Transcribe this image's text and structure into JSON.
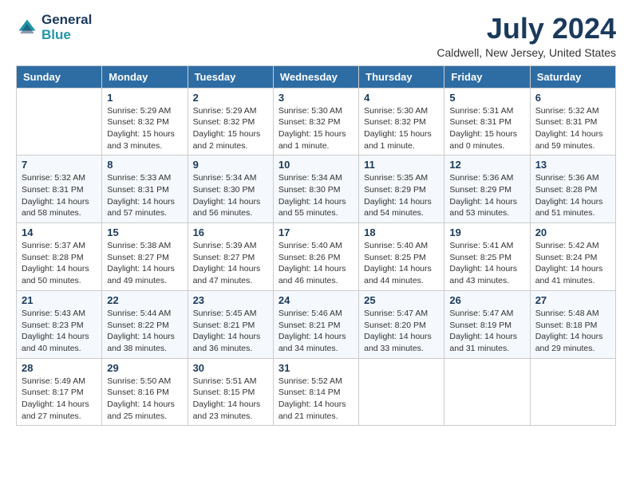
{
  "header": {
    "logo_line1": "General",
    "logo_line2": "Blue",
    "month_year": "July 2024",
    "location": "Caldwell, New Jersey, United States"
  },
  "days_of_week": [
    "Sunday",
    "Monday",
    "Tuesday",
    "Wednesday",
    "Thursday",
    "Friday",
    "Saturday"
  ],
  "weeks": [
    [
      {
        "day": "",
        "info": ""
      },
      {
        "day": "1",
        "info": "Sunrise: 5:29 AM\nSunset: 8:32 PM\nDaylight: 15 hours\nand 3 minutes."
      },
      {
        "day": "2",
        "info": "Sunrise: 5:29 AM\nSunset: 8:32 PM\nDaylight: 15 hours\nand 2 minutes."
      },
      {
        "day": "3",
        "info": "Sunrise: 5:30 AM\nSunset: 8:32 PM\nDaylight: 15 hours\nand 1 minute."
      },
      {
        "day": "4",
        "info": "Sunrise: 5:30 AM\nSunset: 8:32 PM\nDaylight: 15 hours\nand 1 minute."
      },
      {
        "day": "5",
        "info": "Sunrise: 5:31 AM\nSunset: 8:31 PM\nDaylight: 15 hours\nand 0 minutes."
      },
      {
        "day": "6",
        "info": "Sunrise: 5:32 AM\nSunset: 8:31 PM\nDaylight: 14 hours\nand 59 minutes."
      }
    ],
    [
      {
        "day": "7",
        "info": "Sunrise: 5:32 AM\nSunset: 8:31 PM\nDaylight: 14 hours\nand 58 minutes."
      },
      {
        "day": "8",
        "info": "Sunrise: 5:33 AM\nSunset: 8:31 PM\nDaylight: 14 hours\nand 57 minutes."
      },
      {
        "day": "9",
        "info": "Sunrise: 5:34 AM\nSunset: 8:30 PM\nDaylight: 14 hours\nand 56 minutes."
      },
      {
        "day": "10",
        "info": "Sunrise: 5:34 AM\nSunset: 8:30 PM\nDaylight: 14 hours\nand 55 minutes."
      },
      {
        "day": "11",
        "info": "Sunrise: 5:35 AM\nSunset: 8:29 PM\nDaylight: 14 hours\nand 54 minutes."
      },
      {
        "day": "12",
        "info": "Sunrise: 5:36 AM\nSunset: 8:29 PM\nDaylight: 14 hours\nand 53 minutes."
      },
      {
        "day": "13",
        "info": "Sunrise: 5:36 AM\nSunset: 8:28 PM\nDaylight: 14 hours\nand 51 minutes."
      }
    ],
    [
      {
        "day": "14",
        "info": "Sunrise: 5:37 AM\nSunset: 8:28 PM\nDaylight: 14 hours\nand 50 minutes."
      },
      {
        "day": "15",
        "info": "Sunrise: 5:38 AM\nSunset: 8:27 PM\nDaylight: 14 hours\nand 49 minutes."
      },
      {
        "day": "16",
        "info": "Sunrise: 5:39 AM\nSunset: 8:27 PM\nDaylight: 14 hours\nand 47 minutes."
      },
      {
        "day": "17",
        "info": "Sunrise: 5:40 AM\nSunset: 8:26 PM\nDaylight: 14 hours\nand 46 minutes."
      },
      {
        "day": "18",
        "info": "Sunrise: 5:40 AM\nSunset: 8:25 PM\nDaylight: 14 hours\nand 44 minutes."
      },
      {
        "day": "19",
        "info": "Sunrise: 5:41 AM\nSunset: 8:25 PM\nDaylight: 14 hours\nand 43 minutes."
      },
      {
        "day": "20",
        "info": "Sunrise: 5:42 AM\nSunset: 8:24 PM\nDaylight: 14 hours\nand 41 minutes."
      }
    ],
    [
      {
        "day": "21",
        "info": "Sunrise: 5:43 AM\nSunset: 8:23 PM\nDaylight: 14 hours\nand 40 minutes."
      },
      {
        "day": "22",
        "info": "Sunrise: 5:44 AM\nSunset: 8:22 PM\nDaylight: 14 hours\nand 38 minutes."
      },
      {
        "day": "23",
        "info": "Sunrise: 5:45 AM\nSunset: 8:21 PM\nDaylight: 14 hours\nand 36 minutes."
      },
      {
        "day": "24",
        "info": "Sunrise: 5:46 AM\nSunset: 8:21 PM\nDaylight: 14 hours\nand 34 minutes."
      },
      {
        "day": "25",
        "info": "Sunrise: 5:47 AM\nSunset: 8:20 PM\nDaylight: 14 hours\nand 33 minutes."
      },
      {
        "day": "26",
        "info": "Sunrise: 5:47 AM\nSunset: 8:19 PM\nDaylight: 14 hours\nand 31 minutes."
      },
      {
        "day": "27",
        "info": "Sunrise: 5:48 AM\nSunset: 8:18 PM\nDaylight: 14 hours\nand 29 minutes."
      }
    ],
    [
      {
        "day": "28",
        "info": "Sunrise: 5:49 AM\nSunset: 8:17 PM\nDaylight: 14 hours\nand 27 minutes."
      },
      {
        "day": "29",
        "info": "Sunrise: 5:50 AM\nSunset: 8:16 PM\nDaylight: 14 hours\nand 25 minutes."
      },
      {
        "day": "30",
        "info": "Sunrise: 5:51 AM\nSunset: 8:15 PM\nDaylight: 14 hours\nand 23 minutes."
      },
      {
        "day": "31",
        "info": "Sunrise: 5:52 AM\nSunset: 8:14 PM\nDaylight: 14 hours\nand 21 minutes."
      },
      {
        "day": "",
        "info": ""
      },
      {
        "day": "",
        "info": ""
      },
      {
        "day": "",
        "info": ""
      }
    ]
  ]
}
